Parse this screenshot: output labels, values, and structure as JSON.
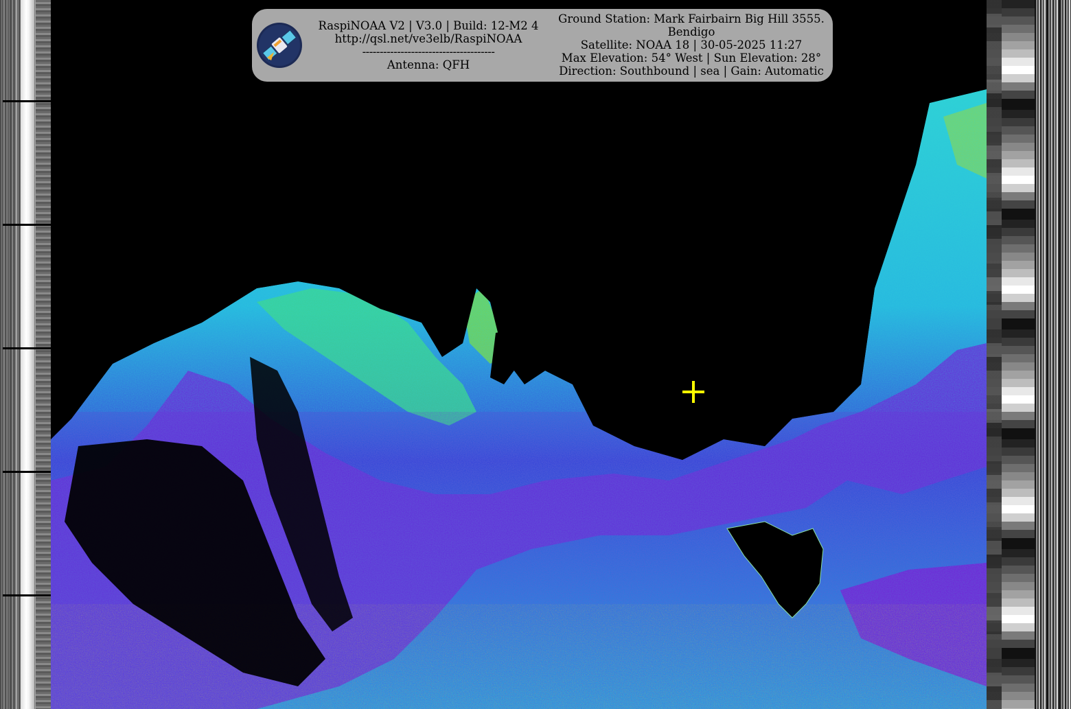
{
  "header": {
    "left_lines": [
      "RaspiNOAA V2 | V3.0 | Build: 12-M2 4",
      "http://qsl.net/ve3elb/RaspiNOAA",
      "--------------------------------------",
      "Antenna: QFH"
    ],
    "right_lines": [
      "Ground Station: Mark Fairbairn Big Hill 3555.",
      "Bendigo",
      "Satellite: NOAA 18 | 30-05-2025 11:27",
      "Max Elevation: 54° West | Sun Elevation: 28°",
      "Direction: Southbound | sea | Gain: Automatic"
    ]
  },
  "logo": {
    "icon": "satellite-icon"
  },
  "marker": {
    "icon": "crosshair-icon",
    "color": "#ffff00"
  },
  "colors": {
    "background": "#000000",
    "info_box": "#a8a8a8",
    "palette": [
      "#7a1fd6",
      "#3a3adc",
      "#2f8fe0",
      "#2fd6d6",
      "#3fd88a",
      "#9ad83a",
      "#d8d83a"
    ]
  }
}
